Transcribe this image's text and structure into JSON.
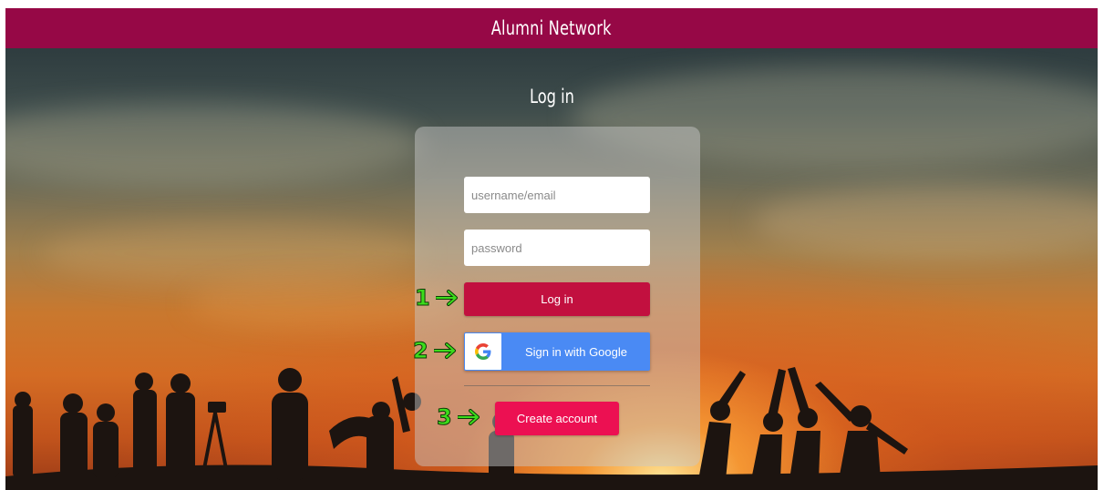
{
  "navbar": {
    "title": "Alumni Network"
  },
  "page": {
    "heading": "Log in"
  },
  "login_form": {
    "username": {
      "placeholder": "username/email",
      "value": ""
    },
    "password": {
      "placeholder": "password",
      "value": ""
    },
    "login_button": "Log in",
    "google_button": "Sign in with Google",
    "create_account_button": "Create account"
  },
  "annotations": [
    {
      "number": "1",
      "icon": "arrow-right-icon",
      "target": "Log in"
    },
    {
      "number": "2",
      "icon": "arrow-right-icon",
      "target": "Sign in with Google"
    },
    {
      "number": "3",
      "icon": "arrow-right-icon",
      "target": "Create account"
    }
  ],
  "colors": {
    "navbar": "#960846",
    "login_button": "#c2103f",
    "google_button": "#4a8af4",
    "create_account_button": "#ec1052",
    "annotation": "#3ddc1c"
  }
}
